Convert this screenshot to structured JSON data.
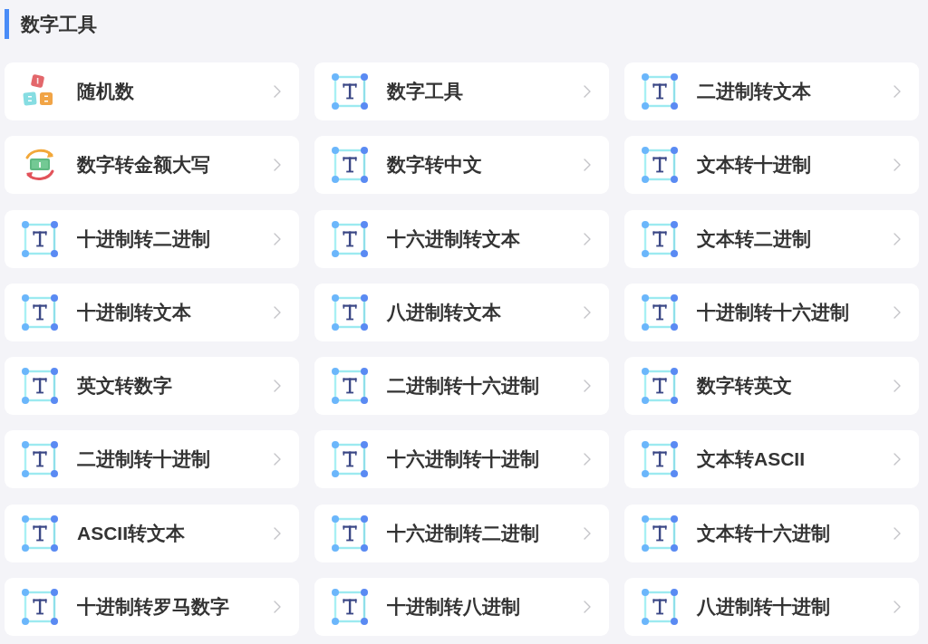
{
  "section": {
    "title": "数字工具"
  },
  "tools": [
    {
      "label": "随机数",
      "kind": "dice"
    },
    {
      "label": "数字工具",
      "kind": "text"
    },
    {
      "label": "二进制转文本",
      "kind": "text"
    },
    {
      "label": "数字转金额大写",
      "kind": "money"
    },
    {
      "label": "数字转中文",
      "kind": "text"
    },
    {
      "label": "文本转十进制",
      "kind": "text"
    },
    {
      "label": "十进制转二进制",
      "kind": "text"
    },
    {
      "label": "十六进制转文本",
      "kind": "text"
    },
    {
      "label": "文本转二进制",
      "kind": "text"
    },
    {
      "label": "十进制转文本",
      "kind": "text"
    },
    {
      "label": "八进制转文本",
      "kind": "text"
    },
    {
      "label": "十进制转十六进制",
      "kind": "text"
    },
    {
      "label": "英文转数字",
      "kind": "text"
    },
    {
      "label": "二进制转十六进制",
      "kind": "text"
    },
    {
      "label": "数字转英文",
      "kind": "text"
    },
    {
      "label": "二进制转十进制",
      "kind": "text"
    },
    {
      "label": "十六进制转十进制",
      "kind": "text"
    },
    {
      "label": "文本转ASCII",
      "kind": "text"
    },
    {
      "label": "ASCII转文本",
      "kind": "text"
    },
    {
      "label": "十六进制转二进制",
      "kind": "text"
    },
    {
      "label": "文本转十六进制",
      "kind": "text"
    },
    {
      "label": "十进制转罗马数字",
      "kind": "text"
    },
    {
      "label": "十进制转八进制",
      "kind": "text"
    },
    {
      "label": "八进制转十进制",
      "kind": "text"
    }
  ]
}
